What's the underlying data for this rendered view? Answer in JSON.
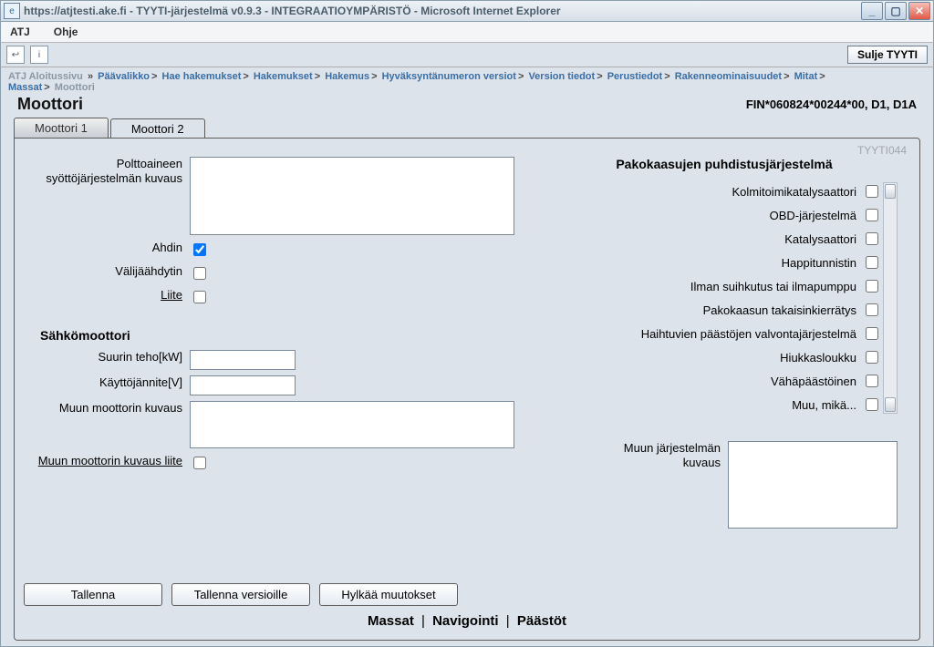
{
  "window": {
    "title": "https://atjtesti.ake.fi - TYYTI-järjestelmä v0.9.3 - INTEGRAATIOYMPÄRISTÖ - Microsoft Internet Explorer"
  },
  "menus": {
    "atj": "ATJ",
    "ohje": "Ohje"
  },
  "toolbar": {
    "close_tyyti": "Sulje TYYTI"
  },
  "breadcrumbs": {
    "items": [
      "ATJ Aloitussivu",
      "Päävalikko",
      "Hae hakemukset",
      "Hakemukset",
      "Hakemus",
      "Hyväksyntänumeron versiot",
      "Version tiedot",
      "Perustiedot",
      "Rakenneominaisuudet",
      "Mitat",
      "Massat",
      "Moottori"
    ],
    "inactive_first": true,
    "inactive_last": true
  },
  "page": {
    "title": "Moottori",
    "doc_id": "FIN*060824*00244*00, D1, D1A",
    "form_code": "TYYTI044"
  },
  "tabs": [
    {
      "label": "Moottori 1",
      "active": false
    },
    {
      "label": "Moottori 2",
      "active": true
    }
  ],
  "left": {
    "fuel_desc_label": "Polttoaineen syöttöjärjestelmän kuvaus",
    "fuel_desc_value": "",
    "ahdin_label": "Ahdin",
    "ahdin_checked": true,
    "valijaahdytin_label": "Välijäähdytin",
    "valijaahdytin_checked": false,
    "liite_label": "Liite",
    "liite_checked": false,
    "section_sahko": "Sähkömoottori",
    "suurin_teho_label": "Suurin teho[kW]",
    "suurin_teho_value": "",
    "kayttojannite_label": "Käyttöjännite[V]",
    "kayttojannite_value": "",
    "muun_moottorin_label": "Muun moottorin kuvaus",
    "muun_moottorin_value": "",
    "muun_liite_label": "Muun moottorin kuvaus liite",
    "muun_liite_checked": false
  },
  "right": {
    "heading": "Pakokaasujen puhdistusjärjestelmä",
    "items": [
      "Kolmitoimikatalysaattori",
      "OBD-järjestelmä",
      "Katalysaattori",
      "Happitunnistin",
      "Ilman suihkutus tai ilmapumppu",
      "Pakokaasun takaisinkierrätys",
      "Haihtuvien päästöjen valvontajärjestelmä",
      "Hiukkasloukku",
      "Vähäpäästöinen",
      "Muu, mikä..."
    ],
    "muun_label": "Muun järjestelmän kuvaus",
    "muun_value": ""
  },
  "buttons": {
    "save": "Tallenna",
    "save_versions": "Tallenna versioille",
    "reject": "Hylkää muutokset"
  },
  "nav": {
    "massat": "Massat",
    "navigointi": "Navigointi",
    "paastot": "Päästöt"
  }
}
